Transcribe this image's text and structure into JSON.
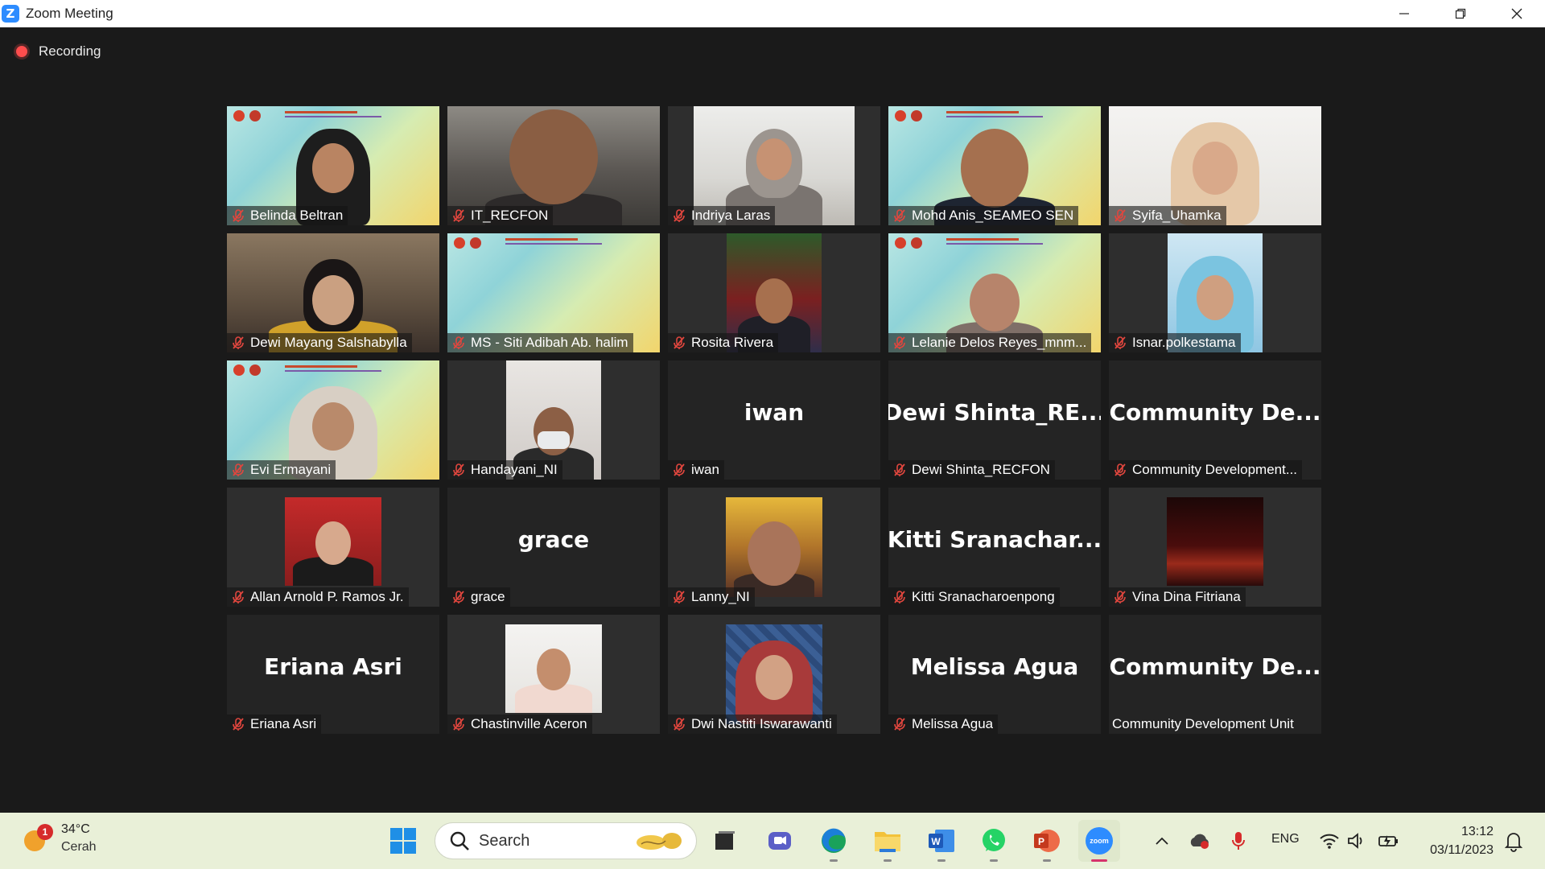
{
  "window": {
    "title": "Zoom Meeting",
    "minimize_glyph": "—",
    "restore_glyph": "❐",
    "close_glyph": "✕"
  },
  "recording": {
    "label": "Recording",
    "color": "#ff4d4d"
  },
  "participants": [
    {
      "name": "Belinda Beltran",
      "video": true,
      "muted": true
    },
    {
      "name": "IT_RECFON",
      "video": true,
      "muted": true
    },
    {
      "name": "Indriya Laras",
      "video": true,
      "muted": true
    },
    {
      "name": "Mohd Anis_SEAMEO SEN",
      "video": true,
      "muted": true
    },
    {
      "name": "Syifa_Uhamka",
      "video": true,
      "muted": true
    },
    {
      "name": "Dewi Mayang Salshabylla",
      "video": true,
      "muted": true
    },
    {
      "name": "MS - Siti Adibah Ab. halim",
      "video": true,
      "muted": true
    },
    {
      "name": "Rosita Rivera",
      "video": true,
      "muted": true
    },
    {
      "name": "Lelanie Delos Reyes_mnm...",
      "video": true,
      "muted": true
    },
    {
      "name": "Isnar.polkestama",
      "video": true,
      "muted": true
    },
    {
      "name": "Evi Ermayani",
      "video": true,
      "muted": true
    },
    {
      "name": "Handayani_NI",
      "video": true,
      "muted": true
    },
    {
      "name": "iwan",
      "video": false,
      "muted": true,
      "display_name": "iwan"
    },
    {
      "name": "Dewi Shinta_RECFON",
      "video": false,
      "muted": true,
      "display_name": "Dewi  Shinta_RE..."
    },
    {
      "name": "Community Development...",
      "video": false,
      "muted": true,
      "display_name": "Community  De..."
    },
    {
      "name": "Allan Arnold P. Ramos Jr.",
      "video": true,
      "muted": true
    },
    {
      "name": "grace",
      "video": false,
      "muted": true,
      "display_name": "grace"
    },
    {
      "name": "Lanny_NI",
      "video": true,
      "muted": true
    },
    {
      "name": "Kitti Sranacharoenpong",
      "video": false,
      "muted": true,
      "display_name": "Kitti  Sranachar..."
    },
    {
      "name": "Vina Dina Fitriana",
      "video": true,
      "muted": true
    },
    {
      "name": "Eriana Asri",
      "video": false,
      "muted": true,
      "display_name": "Eriana Asri"
    },
    {
      "name": "Chastinville Aceron",
      "video": true,
      "muted": true
    },
    {
      "name": "Dwi Nastiti Iswarawanti",
      "video": true,
      "muted": true
    },
    {
      "name": "Melissa Agua",
      "video": false,
      "muted": true,
      "display_name": "Melissa Agua"
    },
    {
      "name": "Community Development Unit",
      "video": false,
      "muted": false,
      "display_name": "Community  De..."
    }
  ],
  "taskbar": {
    "weather": {
      "temp": "34°C",
      "desc": "Cerah",
      "badge": "1"
    },
    "search": {
      "label": "Search"
    },
    "apps": [
      {
        "id": "task-view-icon",
        "running": false
      },
      {
        "id": "teams-chat-icon",
        "running": false
      },
      {
        "id": "edge-icon",
        "running": true
      },
      {
        "id": "file-explorer-icon",
        "running": true
      },
      {
        "id": "word-icon",
        "running": true
      },
      {
        "id": "whatsapp-icon",
        "running": true
      },
      {
        "id": "powerpoint-icon",
        "running": true
      },
      {
        "id": "zoom-icon",
        "running": true,
        "active": true
      }
    ],
    "tray": {
      "language": "ENG"
    },
    "clock": {
      "time": "13:12",
      "date": "03/11/2023"
    }
  },
  "colors": {
    "meeting_bg": "#1a1a1a",
    "tile_bg": "#242424",
    "muted_red": "#e0463e",
    "taskbar_bg": "#e9f0d8",
    "zoom_blue": "#2d8cff"
  }
}
